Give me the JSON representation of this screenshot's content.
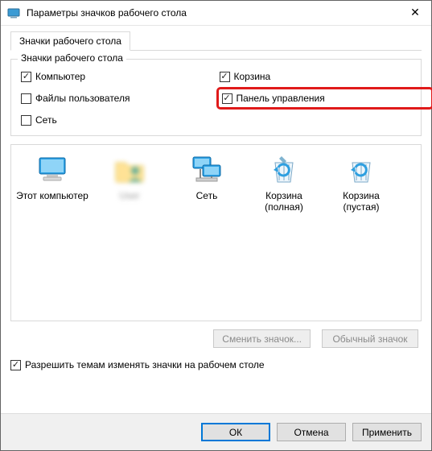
{
  "window": {
    "title": "Параметры значков рабочего стола",
    "close": "✕"
  },
  "tab": {
    "label": "Значки рабочего стола"
  },
  "group": {
    "label": "Значки рабочего стола",
    "items": {
      "computer": {
        "label": "Компьютер",
        "checked": true
      },
      "recycle": {
        "label": "Корзина",
        "checked": true
      },
      "userfiles": {
        "label": "Файлы пользователя",
        "checked": false
      },
      "cpanel": {
        "label": "Панель управления",
        "checked": true
      },
      "network": {
        "label": "Сеть",
        "checked": false
      }
    }
  },
  "icons": {
    "0": {
      "label": "Этот компьютер"
    },
    "1": {
      "label": "User"
    },
    "2": {
      "label": "Сеть"
    },
    "3": {
      "label": "Корзина (полная)"
    },
    "4": {
      "label": "Корзина (пустая)"
    }
  },
  "buttons": {
    "changeIcon": "Сменить значок...",
    "defaultIcon": "Обычный значок",
    "themeAllow": "Разрешить темам изменять значки на рабочем столе",
    "ok": "ОК",
    "cancel": "Отмена",
    "apply": "Применить"
  },
  "checkmark": "✓"
}
